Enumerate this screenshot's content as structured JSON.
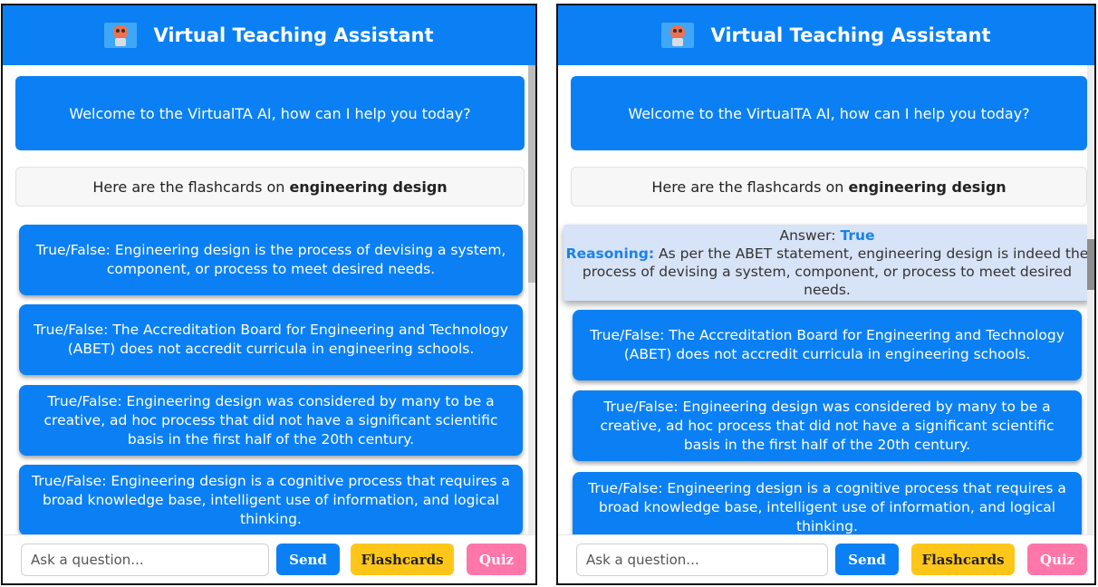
{
  "header": {
    "title": "Virtual Teaching Assistant",
    "logo_icon": "robot-icon"
  },
  "chat": {
    "welcome": "Welcome to the VirtualTA AI, how can I help you today?",
    "flashcards_intro": "Here are the flashcards on",
    "flashcards_topic": "engineering design"
  },
  "flashcards": [
    {
      "question": "True/False: Engineering design is the process of devising a system, component, or process to meet desired needs."
    },
    {
      "question": "True/False: The Accreditation Board for Engineering and Technology (ABET) does not accredit curricula in engineering schools."
    },
    {
      "question": "True/False: Engineering design was considered by many to be a creative, ad hoc process that did not have a significant scientific basis in the first half of the 20th century."
    },
    {
      "question": "True/False: Engineering design is a cognitive process that requires a broad knowledge base, intelligent use of information, and logical thinking."
    }
  ],
  "answer_card": {
    "answer_label": "Answer:",
    "answer_value": "True",
    "reasoning_label": "Reasoning:",
    "reasoning_text": "As per the ABET statement, engineering design is indeed the process of devising a system, component, or process to meet desired needs."
  },
  "input_bar": {
    "placeholder": "Ask a question...",
    "send_label": "Send",
    "flashcards_label": "Flashcards",
    "quiz_label": "Quiz"
  },
  "colors": {
    "primary": "#0b80f4",
    "flashcards_button": "#ffc61a",
    "quiz_button": "#ff77a8",
    "answer_background": "#d7e3f6"
  }
}
